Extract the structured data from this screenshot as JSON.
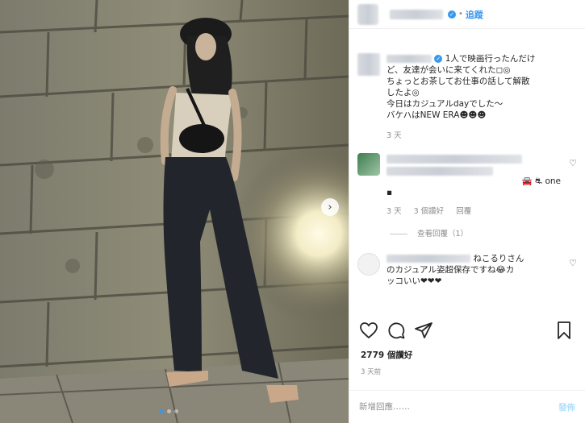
{
  "post": {
    "follow_label": "追蹤",
    "nav_next_glyph": "›",
    "carousel": {
      "count": 3,
      "active": 1
    }
  },
  "caption": {
    "lines": [
      "1人で映画行ったんだけ",
      "ど、友達が会いに来てくれた◻︎◎",
      "ちょっとお茶してお仕事の話して解散",
      "したよ◎",
      "今日はカジュアルdayでした～",
      "バケハはNEW ERA☻☻☻"
    ],
    "age": "3 天"
  },
  "comment1": {
    "extra_line": "🚘 ⛐ one",
    "mark": "▪",
    "age": "3 天",
    "likes": "3 個讚好",
    "reply_label": "回覆",
    "view_replies": "查看回覆（1）"
  },
  "comment2": {
    "lines": [
      "ねこるりさん",
      "のカジュアル姿超保存ですね😂カ",
      "ッコいい❤❤❤"
    ]
  },
  "likes_text": "2779 個讚好",
  "posted_ago": "3 天前",
  "add_comment": {
    "placeholder": "新增回應……",
    "post_label": "發佈"
  },
  "colors": {
    "accent": "#3897f0",
    "post_disabled": "#b2dffc",
    "muted": "#8e8e8e"
  }
}
